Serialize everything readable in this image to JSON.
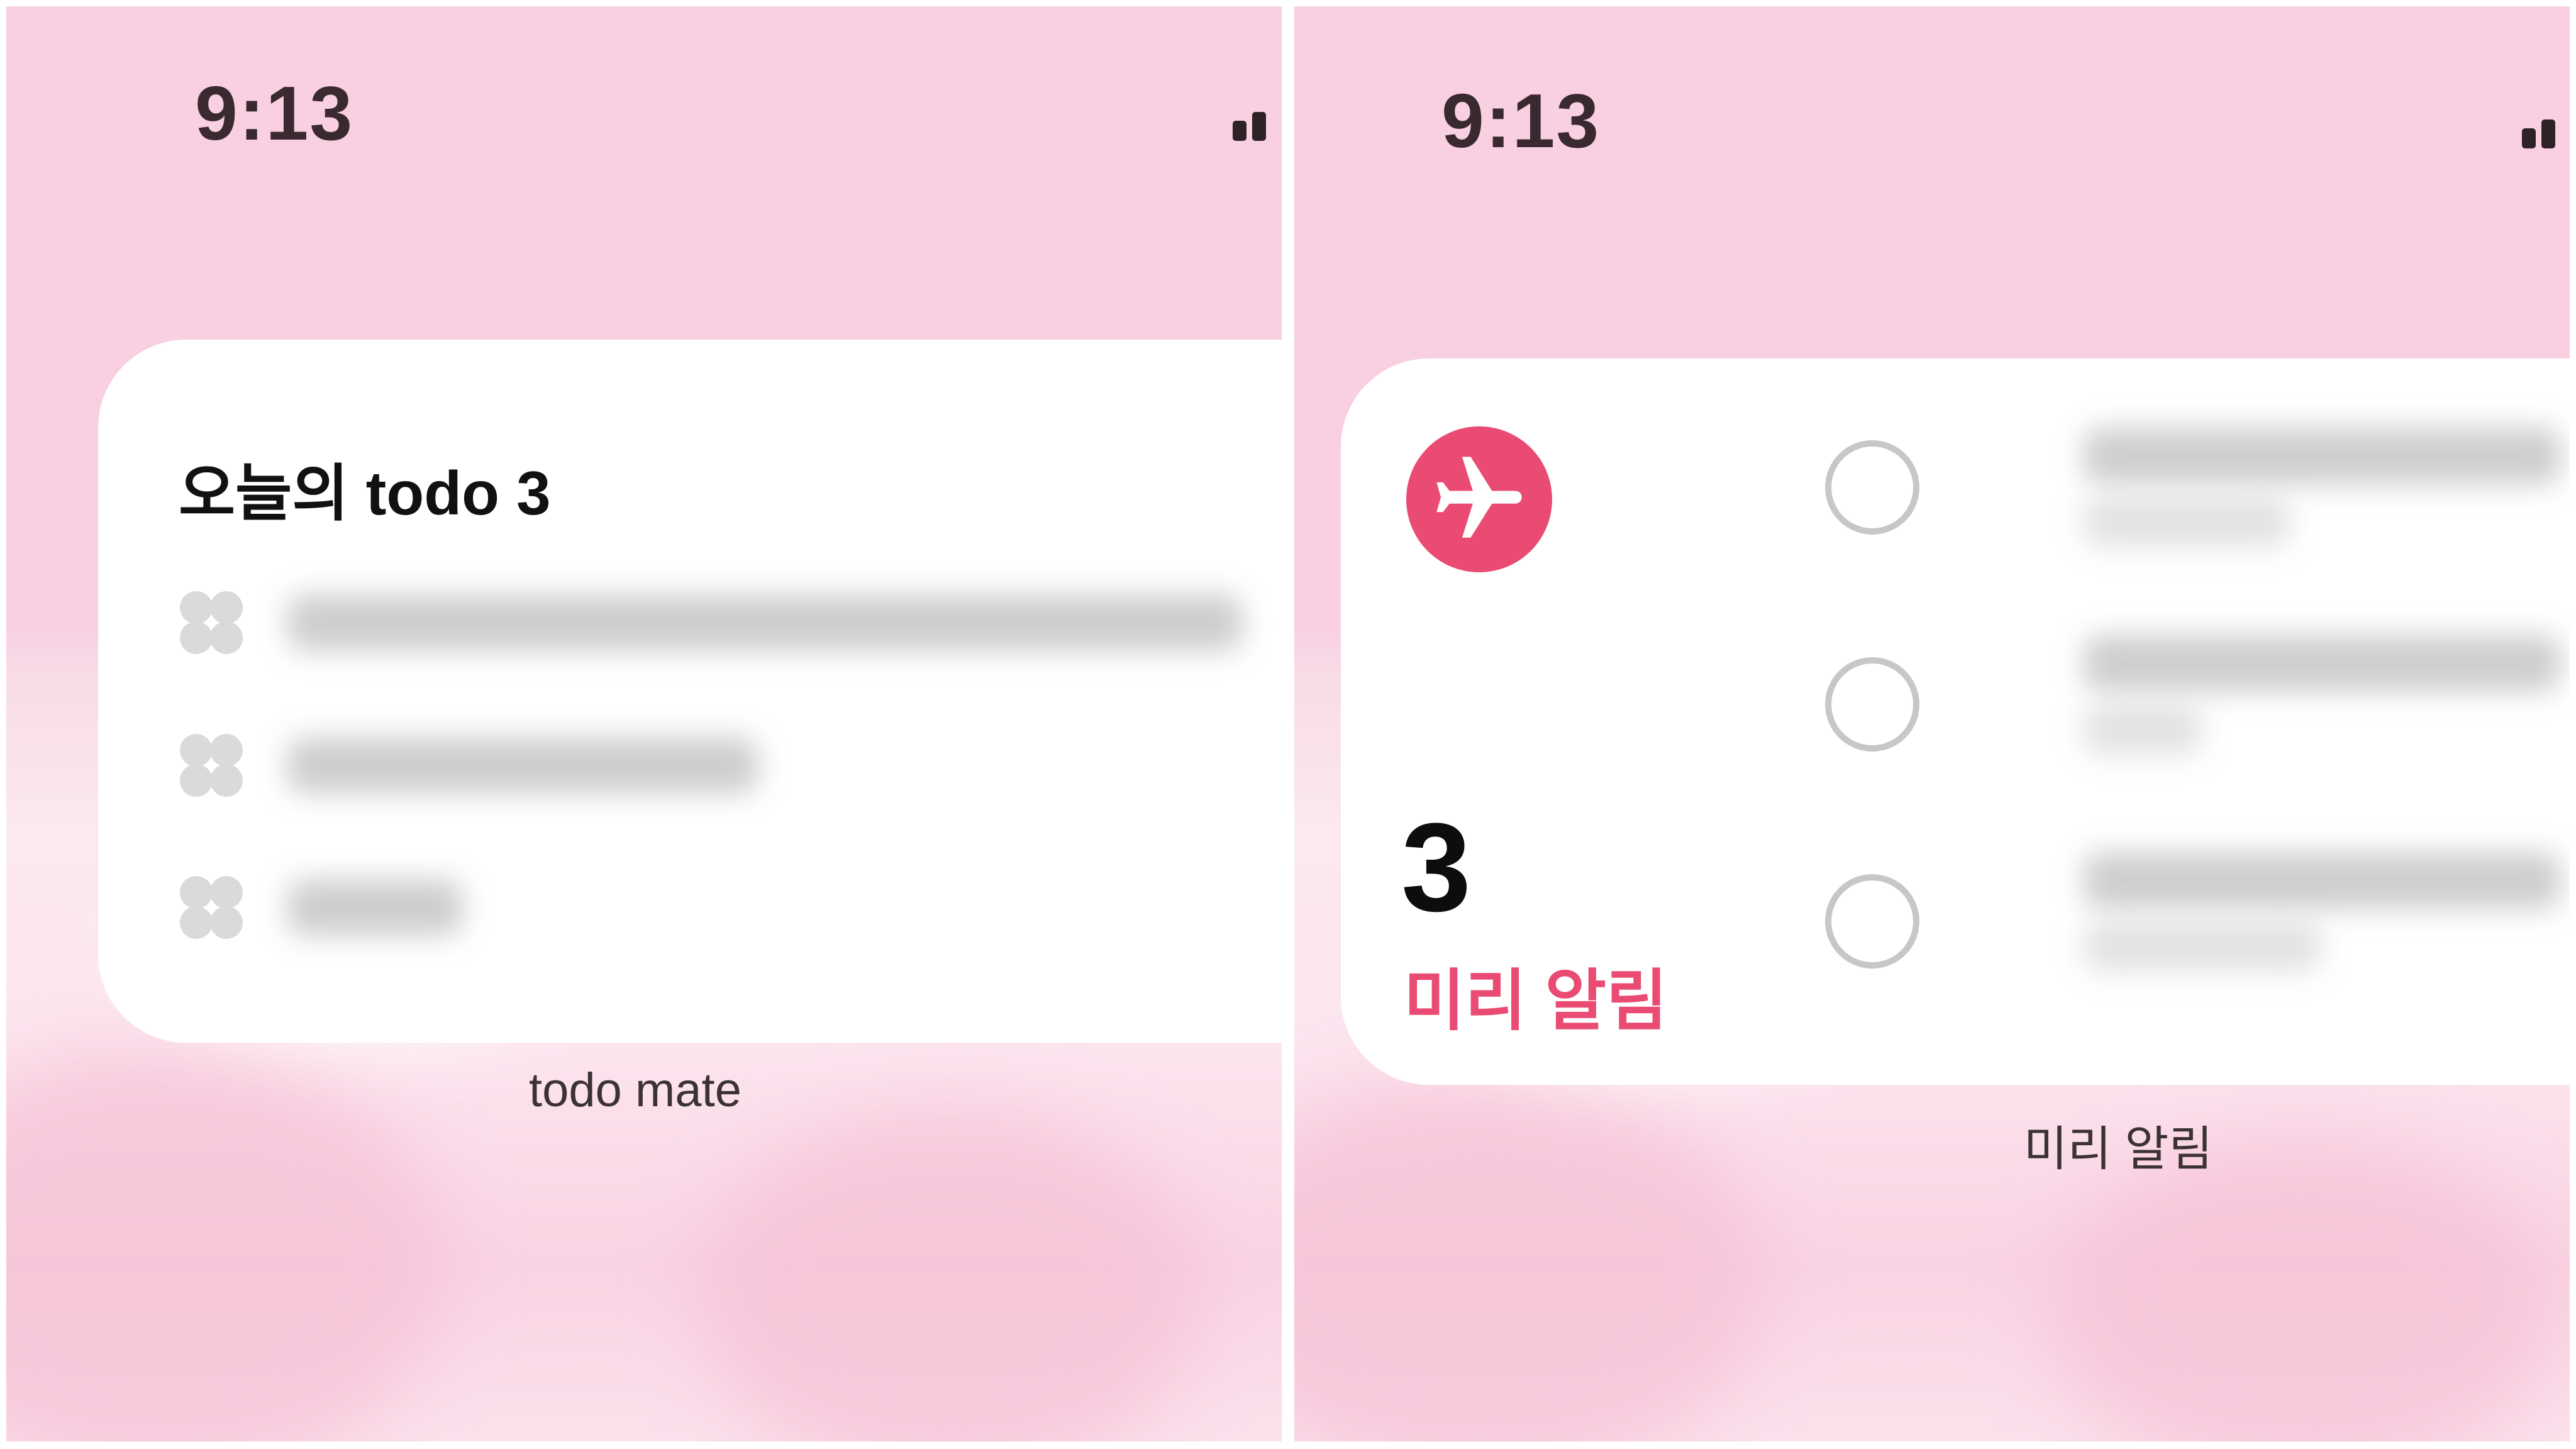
{
  "colors": {
    "background_pink": "#f9cfe2",
    "accent_pink": "#e94b73",
    "widget_bg": "#ffffff",
    "placeholder_gray": "#d9dadb"
  },
  "left_screen": {
    "status_time": "9:13",
    "signal_icon": "signal-bars-icon",
    "widget": {
      "title": "오늘의 todo 3",
      "items": [
        {
          "icon": "clover-checkbox-icon",
          "text_blurred": true
        },
        {
          "icon": "clover-checkbox-icon",
          "text_blurred": true
        },
        {
          "icon": "clover-checkbox-icon",
          "text_blurred": true
        }
      ]
    },
    "widget_label": "todo mate"
  },
  "right_screen": {
    "status_time": "9:13",
    "signal_icon": "signal-bars-icon",
    "widget": {
      "list_icon": "airplane-icon",
      "count": "3",
      "list_name": "미리 알림",
      "items": [
        {
          "icon": "empty-circle-checkbox-icon",
          "text_blurred": true
        },
        {
          "icon": "empty-circle-checkbox-icon",
          "text_blurred": true
        },
        {
          "icon": "empty-circle-checkbox-icon",
          "text_blurred": true
        }
      ]
    },
    "widget_label": "미리 알림"
  }
}
